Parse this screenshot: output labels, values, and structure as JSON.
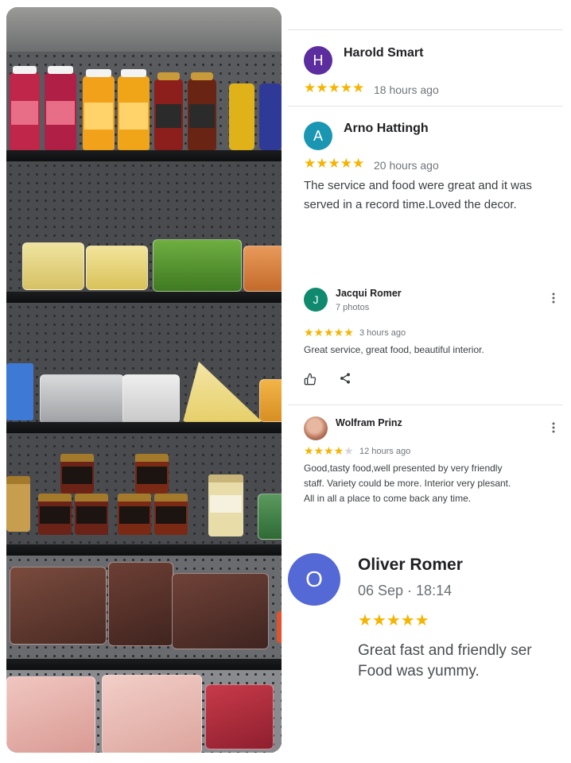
{
  "photo": {
    "alt_subject": "refrigerated deli display shelves"
  },
  "reviews": [
    {
      "initial": "H",
      "avatar_color": "#5b2d9e",
      "name": "Harold Smart",
      "rating": 5,
      "stars_text": "★★★★★",
      "time": "18 hours ago",
      "text": ""
    },
    {
      "initial": "A",
      "avatar_color": "#1a96b3",
      "name": "Arno Hattingh",
      "rating": 5,
      "stars_text": "★★★★★",
      "time": "20 hours ago",
      "text_line1": "The service and food were great and it was",
      "text_line2": "served in a record time.Loved the decor."
    },
    {
      "initial": "J",
      "avatar_color": "#0f8a6e",
      "name": "Jacqui Romer",
      "subtitle": "7 photos",
      "rating": 5,
      "stars_text": "★★★★★",
      "time": "3 hours ago",
      "text": "Great service, great food, beautiful interior.",
      "actions": [
        "thumbs-up",
        "share"
      ]
    },
    {
      "initial": "",
      "name": "Wolfram Prinz",
      "rating": 4,
      "stars_on": "★★★★",
      "stars_off": "★",
      "time": "12 hours ago",
      "text_line1": "Good,tasty food,well presented by very friendly",
      "text_line2": "staff. Variety could be more. Interior very plesant.",
      "text_line3": "All in all a place to come back any time."
    },
    {
      "initial": "O",
      "avatar_color": "#5468d6",
      "name": "Oliver Romer",
      "date": "06 Sep · 18:14",
      "rating": 5,
      "stars_text": "★★★★★",
      "text_line1": "Great fast and friendly ser",
      "text_line2": "Food was yummy."
    }
  ],
  "icons": {
    "more": "more-vert-icon",
    "like": "thumbs-up-icon",
    "share": "share-icon"
  }
}
